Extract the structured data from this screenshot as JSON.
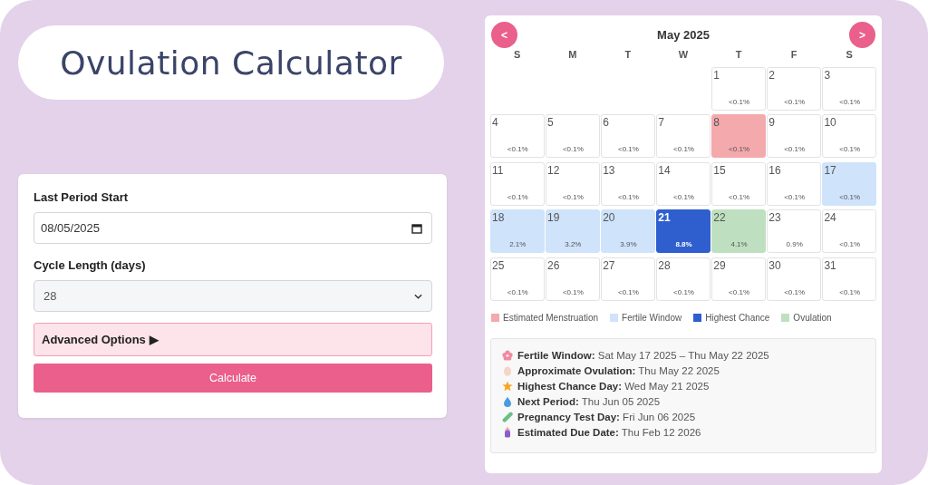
{
  "title": "Ovulation Calculator",
  "form": {
    "last_period_label": "Last Period Start",
    "last_period_value": "08/05/2025",
    "cycle_label": "Cycle Length (days)",
    "cycle_value": "28",
    "advanced": {
      "label": "Advanced Options",
      "arrow": "▶",
      "expanded": false
    },
    "calculate": "Calculate"
  },
  "calendar": {
    "prev": "<",
    "next": ">",
    "month": "May 2025",
    "weekdays": [
      "S",
      "M",
      "T",
      "W",
      "T",
      "F",
      "S"
    ],
    "weeks": [
      [
        {
          "kind": "empty"
        },
        {
          "kind": "empty"
        },
        {
          "kind": "empty"
        },
        {
          "kind": "empty"
        },
        {
          "day": "1",
          "chance": "<0.1%",
          "kind": "normal"
        },
        {
          "day": "2",
          "chance": "<0.1%",
          "kind": "normal"
        },
        {
          "day": "3",
          "chance": "<0.1%",
          "kind": "normal"
        }
      ],
      [
        {
          "day": "4",
          "chance": "<0.1%",
          "kind": "normal"
        },
        {
          "day": "5",
          "chance": "<0.1%",
          "kind": "normal"
        },
        {
          "day": "6",
          "chance": "<0.1%",
          "kind": "normal"
        },
        {
          "day": "7",
          "chance": "<0.1%",
          "kind": "normal"
        },
        {
          "day": "8",
          "chance": "<0.1%",
          "kind": "menstruation"
        },
        {
          "day": "9",
          "chance": "<0.1%",
          "kind": "normal"
        },
        {
          "day": "10",
          "chance": "<0.1%",
          "kind": "normal"
        }
      ],
      [
        {
          "day": "11",
          "chance": "<0.1%",
          "kind": "normal"
        },
        {
          "day": "12",
          "chance": "<0.1%",
          "kind": "normal"
        },
        {
          "day": "13",
          "chance": "<0.1%",
          "kind": "normal"
        },
        {
          "day": "14",
          "chance": "<0.1%",
          "kind": "normal"
        },
        {
          "day": "15",
          "chance": "<0.1%",
          "kind": "normal"
        },
        {
          "day": "16",
          "chance": "<0.1%",
          "kind": "normal"
        },
        {
          "day": "17",
          "chance": "<0.1%",
          "kind": "fertile"
        }
      ],
      [
        {
          "day": "18",
          "chance": "2.1%",
          "kind": "fertile"
        },
        {
          "day": "19",
          "chance": "3.2%",
          "kind": "fertile"
        },
        {
          "day": "20",
          "chance": "3.9%",
          "kind": "fertile"
        },
        {
          "day": "21",
          "chance": "8.8%",
          "kind": "peak"
        },
        {
          "day": "22",
          "chance": "4.1%",
          "kind": "ovulation"
        },
        {
          "day": "23",
          "chance": "0.9%",
          "kind": "normal"
        },
        {
          "day": "24",
          "chance": "<0.1%",
          "kind": "normal"
        }
      ],
      [
        {
          "day": "25",
          "chance": "<0.1%",
          "kind": "normal"
        },
        {
          "day": "26",
          "chance": "<0.1%",
          "kind": "normal"
        },
        {
          "day": "27",
          "chance": "<0.1%",
          "kind": "normal"
        },
        {
          "day": "28",
          "chance": "<0.1%",
          "kind": "normal"
        },
        {
          "day": "29",
          "chance": "<0.1%",
          "kind": "normal"
        },
        {
          "day": "30",
          "chance": "<0.1%",
          "kind": "normal"
        },
        {
          "day": "31",
          "chance": "<0.1%",
          "kind": "normal"
        }
      ]
    ],
    "legend": [
      {
        "label": "Estimated Menstruation",
        "color": "#f4a9ad"
      },
      {
        "label": "Fertile Window",
        "color": "#cfe3fa"
      },
      {
        "label": "Highest Chance",
        "color": "#2f5fcf"
      },
      {
        "label": "Ovulation",
        "color": "#bfe0c0"
      }
    ]
  },
  "summary": [
    {
      "kind": "flower",
      "label": "Fertile Window:",
      "value": "Sat May 17 2025 – Thu May 22 2025"
    },
    {
      "kind": "egg",
      "label": "Approximate Ovulation:",
      "value": "Thu May 22 2025"
    },
    {
      "kind": "star",
      "label": "Highest Chance Day:",
      "value": "Wed May 21 2025"
    },
    {
      "kind": "drop",
      "label": "Next Period:",
      "value": "Thu Jun 05 2025"
    },
    {
      "kind": "pill",
      "label": "Pregnancy Test Day:",
      "value": "Fri Jun 06 2025"
    },
    {
      "kind": "bottle",
      "label": "Estimated Due Date:",
      "value": "Thu Feb 12 2026"
    }
  ]
}
